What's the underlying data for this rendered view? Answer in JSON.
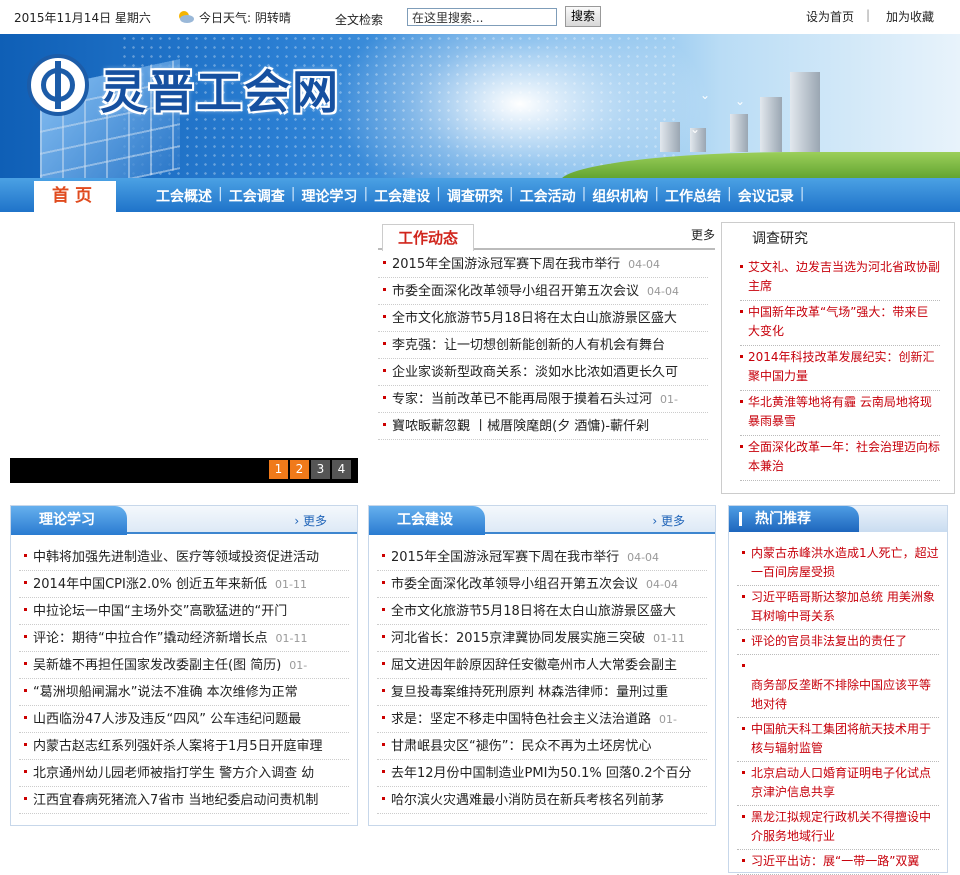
{
  "topbar": {
    "date": "2015年11月14日 星期六",
    "weather": "今日天气: 阴转晴",
    "fulltext_label": "全文检索",
    "search_value": "在这里搜索...",
    "search_button": "搜索",
    "set_home": "设为首页",
    "separator": "|",
    "add_fav": "加为收藏"
  },
  "banner": {
    "site_title": "灵晋工会网"
  },
  "nav": {
    "home": "首页",
    "items": [
      "工会概述",
      "工会调查",
      "理论学习",
      "工会建设",
      "调查研究",
      "工会活动",
      "组织机构",
      "工作总结",
      "会议记录"
    ]
  },
  "slideshow": {
    "pages": [
      "1",
      "2",
      "3",
      "4"
    ],
    "active": "1"
  },
  "work": {
    "title": "工作动态",
    "more": "更多",
    "items": [
      {
        "text": "2015年全国游泳冠军赛下周在我市举行",
        "date": "04-04"
      },
      {
        "text": "市委全面深化改革领导小组召开第五次会议",
        "date": "04-04"
      },
      {
        "text": "全市文化旅游节5月18日将在太白山旅游景区盛大",
        "date": ""
      },
      {
        "text": "李克强：让一切想创新能创新的人有机会有舞台",
        "date": ""
      },
      {
        "text": "企业家谈新型政商关系：淡如水比浓如酒更长久可",
        "date": ""
      },
      {
        "text": "专家：当前改革已不能再局限于摸着石头过河",
        "date": "01-"
      },
      {
        "text": "寶哝眅蘄忽覲 丨械厝険麾朗(夕 酒慵)-蘄仟剁",
        "date": ""
      }
    ]
  },
  "research": {
    "title": "调查研究",
    "items": [
      "艾文礼、边发吉当选为河北省政协副主席",
      "中国新年改革“气场”强大：带来巨大变化",
      "2014年科技改革发展纪实：创新汇聚中国力量",
      "华北黄淮等地将有霾 云南局地将现暴雨暴雪",
      "全面深化改革一年：社会治理迈向标本兼治"
    ]
  },
  "theory": {
    "title": "理论学习",
    "more": "更多",
    "items": [
      {
        "text": "中韩将加强先进制造业、医疗等领域投资促进活动",
        "date": ""
      },
      {
        "text": "2014年中国CPI涨2.0% 创近五年来新低",
        "date": "01-11"
      },
      {
        "text": "中拉论坛一中国“主场外交”高歌猛进的“开门",
        "date": ""
      },
      {
        "text": "评论：期待“中拉合作”撬动经济新增长点",
        "date": "01-11"
      },
      {
        "text": "吴新雄不再担任国家发改委副主任(图 简历)",
        "date": "01-"
      },
      {
        "text": "“葛洲坝船闸漏水”说法不准确 本次维修为正常",
        "date": ""
      },
      {
        "text": "山西临汾47人涉及违反“四风” 公车违纪问题最",
        "date": ""
      },
      {
        "text": "内蒙古赵志红系列强奸杀人案将于1月5日开庭审理",
        "date": ""
      },
      {
        "text": "北京通州幼儿园老师被指打学生 警方介入调查 幼",
        "date": ""
      },
      {
        "text": "江西宜春病死猪流入7省市 当地纪委启动问责机制",
        "date": ""
      }
    ]
  },
  "building": {
    "title": "工会建设",
    "more": "更多",
    "items": [
      {
        "text": "2015年全国游泳冠军赛下周在我市举行",
        "date": "04-04"
      },
      {
        "text": "市委全面深化改革领导小组召开第五次会议",
        "date": "04-04"
      },
      {
        "text": "全市文化旅游节5月18日将在太白山旅游景区盛大",
        "date": ""
      },
      {
        "text": "河北省长：2015京津冀协同发展实施三突破",
        "date": "01-11"
      },
      {
        "text": "屈文进因年龄原因辞任安徽亳州市人大常委会副主",
        "date": ""
      },
      {
        "text": "复旦投毒案维持死刑原判 林森浩律师：量刑过重",
        "date": ""
      },
      {
        "text": "求是：坚定不移走中国特色社会主义法治道路",
        "date": "01-"
      },
      {
        "text": "甘肃岷县灾区“褪伤”：民众不再为土坯房忧心",
        "date": ""
      },
      {
        "text": "去年12月份中国制造业PMI为50.1% 回落0.2个百分",
        "date": ""
      },
      {
        "text": "哈尔滨火灾遇难最小消防员在新兵考核名列前茅",
        "date": ""
      }
    ]
  },
  "hot": {
    "title": "热门推荐",
    "items": [
      "内蒙古赤峰洪水造成1人死亡，超过一百间房屋受损",
      "习近平晤哥斯达黎加总统 用美洲象耳树喻中哥关系",
      "评论的官员非法复出的责任了",
      "商务部反垄断不排除中国应该平等地对待",
      "中国航天科工集团将航天技术用于核与辐射监管",
      "北京启动人口婚育证明电子化试点 京津沪信息共享",
      "黑龙江拟规定行政机关不得擅设中介服务地域行业",
      "习近平出访：展“一带一路”双翼"
    ]
  },
  "colors": {
    "nav_blue": "#1f73c9",
    "headline_red": "#c7000b",
    "home_orange": "#e04b1e",
    "page_active": "#f07a1a"
  }
}
